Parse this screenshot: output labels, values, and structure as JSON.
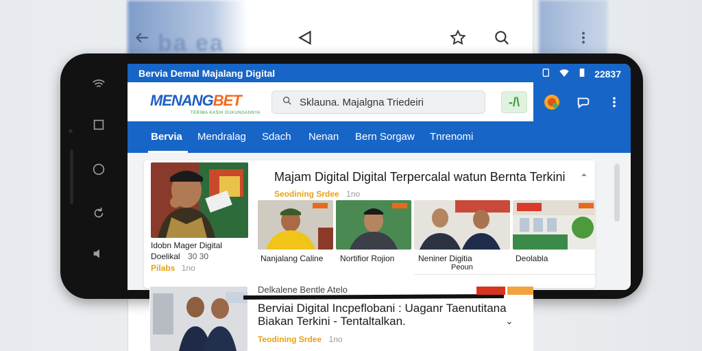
{
  "background_browser": {
    "ghost_text": "ba ea",
    "icons": [
      "back-arrow-icon",
      "share-icon",
      "star-icon",
      "search-icon",
      "more-vert-icon"
    ]
  },
  "phone_side_buttons": [
    "wifi-icon",
    "square-icon",
    "circle-icon",
    "refresh-icon",
    "volume-icon"
  ],
  "status_bar": {
    "title": "Bervia Demal Majalang Digital",
    "time": "22837"
  },
  "header": {
    "logo_part1": "MENANG",
    "logo_part2": "BET",
    "logo_tagline": "TERIMA KASIH DUKUNGANNYA",
    "search_placeholder": "Sklauna. Majalgna Triedeiri",
    "green_button": "-/\\",
    "icons": [
      "avatar-icon",
      "chat-icon",
      "more-vert-icon"
    ]
  },
  "nav": {
    "items": [
      "Bervia",
      "Mendralag",
      "Sdach",
      "Nenan",
      "Bern Sorgaw",
      "Tnrenomi"
    ],
    "active": 0
  },
  "featured": {
    "title": "Majam Digital Digital Terpercalal watun Bernta Terkini",
    "meta_orange": "Seodining Srdee",
    "meta_grey": "1no",
    "main_caption_line1": "Idobn Mager Digital",
    "main_caption_line2": "Doelikal",
    "main_caption_grey": "30 30",
    "main_meta_orange": "Pilabs",
    "main_meta_grey": "1no",
    "sub_items": [
      {
        "caption": "Nanjalang Caline",
        "caption2": ""
      },
      {
        "caption": "Nortifior Rojion",
        "caption2": ""
      },
      {
        "caption": "Neniner Digitia",
        "caption2": "Peoun"
      },
      {
        "caption": "Deolabla",
        "caption2": ""
      }
    ]
  },
  "second": {
    "overline": "Delkalene Bentle Atelo",
    "title_line1": "Berviai Digital Incpeflobani : Uaganr Taenutitana",
    "title_line2": "Biakan Terkini - Tentaltalkan.",
    "meta_orange": "Teodining Srdee",
    "meta_grey": "1no"
  },
  "colors": {
    "primary_blue": "#1765c7",
    "accent_orange": "#f26a1b",
    "meta_orange": "#e8a017"
  }
}
